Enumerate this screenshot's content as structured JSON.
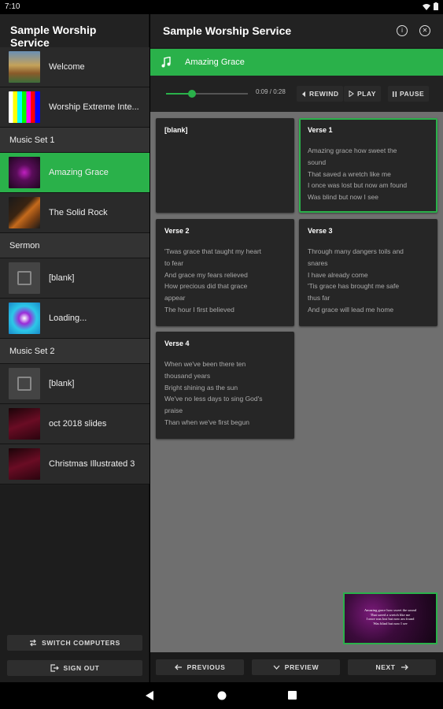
{
  "status_bar": {
    "time": "7:10"
  },
  "sidebar": {
    "title": "Sample Worship Service",
    "items": [
      {
        "type": "item",
        "label": "Welcome",
        "thumb": "landscape",
        "active": false
      },
      {
        "type": "item",
        "label": "Worship Extreme Inte...",
        "thumb": "colorbars",
        "active": false
      },
      {
        "type": "section",
        "label": "Music Set 1"
      },
      {
        "type": "item",
        "label": "Amazing Grace",
        "thumb": "purple",
        "active": true
      },
      {
        "type": "item",
        "label": "The Solid Rock",
        "thumb": "rock",
        "active": false
      },
      {
        "type": "section",
        "label": "Sermon"
      },
      {
        "type": "item",
        "label": "[blank]",
        "thumb": "blank",
        "active": false
      },
      {
        "type": "item",
        "label": "Loading...",
        "thumb": "cyan",
        "active": false
      },
      {
        "type": "section",
        "label": "Music Set 2"
      },
      {
        "type": "item",
        "label": "[blank]",
        "thumb": "blank",
        "active": false
      },
      {
        "type": "item",
        "label": "oct 2018 slides",
        "thumb": "crimson",
        "active": false
      },
      {
        "type": "item",
        "label": "Christmas Illustrated 3",
        "thumb": "crimson",
        "active": false
      }
    ],
    "switch_label": "SWITCH COMPUTERS",
    "signout_label": "SIGN OUT"
  },
  "header": {
    "title": "Sample Worship Service"
  },
  "now_playing": {
    "title": "Amazing Grace"
  },
  "transport": {
    "time": "0:09 / 0:28",
    "progress": 0.32,
    "rewind_label": "REWIND",
    "play_label": "PLAY",
    "pause_label": "PAUSE"
  },
  "slides": [
    {
      "title": "[blank]",
      "lines": [],
      "selected": false
    },
    {
      "title": "Verse 1",
      "lines": [
        "Amazing grace how sweet the",
        "sound",
        "That saved a wretch like me",
        "I once was lost but now am found",
        "Was blind but now I see"
      ],
      "selected": true
    },
    {
      "title": "Verse 2",
      "lines": [
        "'Twas grace that taught my heart",
        "to fear",
        "And grace my fears relieved",
        "How precious did that grace",
        "appear",
        "The hour I first believed"
      ],
      "selected": false
    },
    {
      "title": "Verse 3",
      "lines": [
        "Through many dangers toils and",
        "snares",
        "I have already come",
        "'Tis grace has brought me safe",
        "thus far",
        "And grace will lead me home"
      ],
      "selected": false
    },
    {
      "title": "Verse 4",
      "lines": [
        "When we've been there ten",
        "thousand years",
        "Bright shining as the sun",
        "We've no less days to sing God's",
        "praise",
        "Than when we've first begun"
      ],
      "selected": false
    }
  ],
  "preview": {
    "lines": [
      "Amazing grace how sweet the sound",
      "That saved a wretch like me",
      "I once was lost but now am found",
      "Was blind but now I see"
    ]
  },
  "bottom": {
    "previous_label": "PREVIOUS",
    "preview_label": "PREVIEW",
    "next_label": "NEXT"
  },
  "colors": {
    "accent": "#2ab14a",
    "panel": "#262626",
    "slide_bg": "#6f6f6f"
  }
}
